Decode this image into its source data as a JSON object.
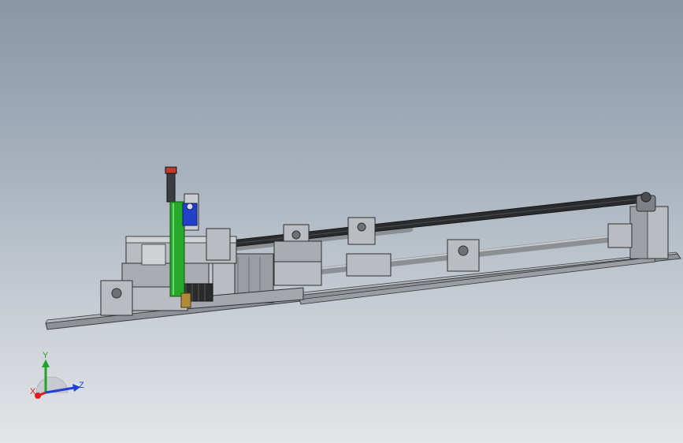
{
  "window": {
    "type": "cad-3d-viewport"
  },
  "model": {
    "description_visible": false
  },
  "triad": {
    "x_label": "X",
    "y_label": "Y",
    "z_label": "Z",
    "x_color": "#d81e1e",
    "y_color": "#1fa32a",
    "z_color": "#1f3fd6"
  },
  "colors": {
    "background_top": "#8996a6",
    "background_bottom": "#e3e5e8",
    "metal": "#b9bcc0",
    "metal_dark": "#6e7175",
    "belt": "#2a2b2d",
    "green_cylinder": "#27a82b",
    "blue_part": "#2340c8",
    "red_part": "#c0392b"
  }
}
